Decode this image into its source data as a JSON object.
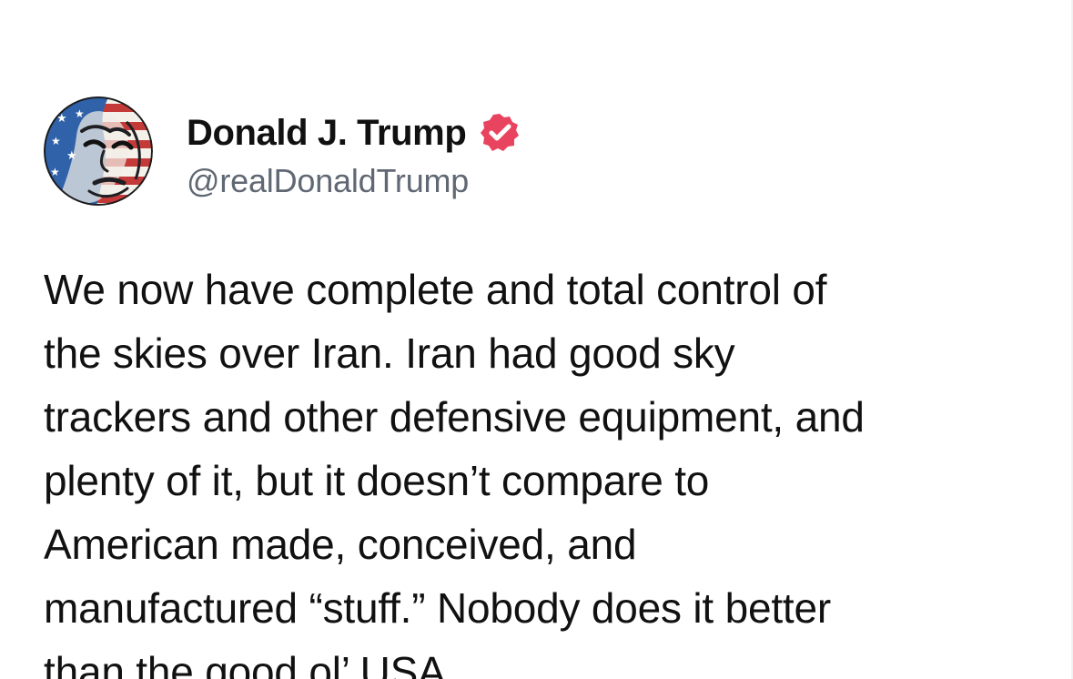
{
  "post": {
    "author": {
      "display_name": "Donald J. Trump",
      "handle": "@realDonaldTrump",
      "verified": true,
      "avatar_icon": "flag-painted-portrait-avatar",
      "verified_icon": "verified-badge-icon"
    },
    "body_lines": [
      "We now have complete and total control of",
      "the skies over Iran. Iran had good sky",
      "trackers and other defensive equipment, and",
      "plenty of it, but it doesn’t compare to",
      "American made, conceived, and",
      "manufactured “stuff.” Nobody does it better",
      "than the good ol’ USA."
    ]
  },
  "colors": {
    "background": "#ffffff",
    "text": "#111111",
    "handle": "#606873",
    "verified_badge": "#e9445f",
    "flag_red": "#c43a38",
    "flag_blue": "#2f62a8"
  }
}
